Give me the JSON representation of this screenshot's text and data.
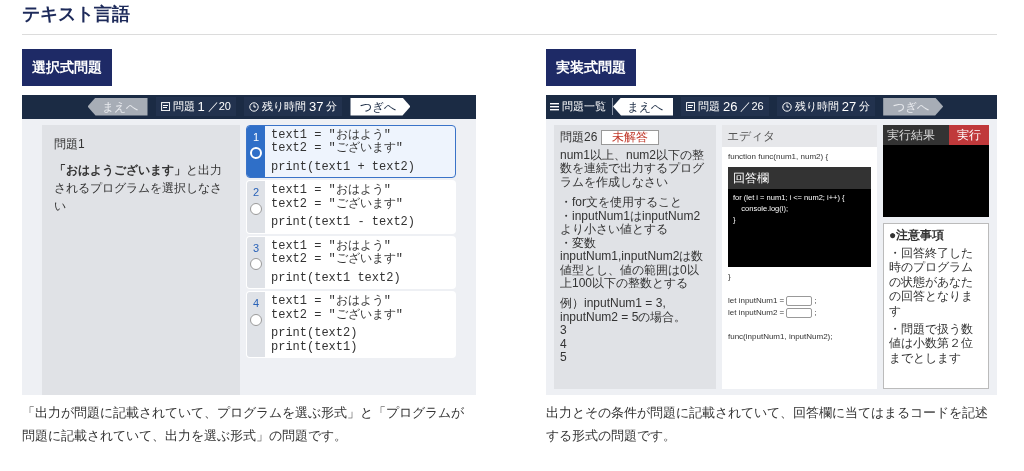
{
  "heading": "テキスト言語",
  "sections": [
    {
      "kind": "choice",
      "badge": "選択式問題",
      "screen": {
        "toolbar": {
          "prev": {
            "label": "まえへ",
            "disabled": true
          },
          "question_label": "問題",
          "current": "1",
          "total": "／20",
          "time_label": "残り時間",
          "minutes": "37",
          "unit": "分",
          "next": {
            "label": "つぎへ",
            "disabled": false
          }
        },
        "question": {
          "title": "問題1",
          "text": "**「おはようございます」**と出力されるプログラムを選択しなさい"
        },
        "choices": [
          {
            "number": "1",
            "code": "text1 = \"おはよう\"\ntext2 = \"ございます\"\n\nprint(text1 + text2)",
            "selected": true
          },
          {
            "number": "2",
            "code": "text1 = \"おはよう\"\ntext2 = \"ございます\"\n\nprint(text1 - text2)",
            "selected": false
          },
          {
            "number": "3",
            "code": "text1 = \"おはよう\"\ntext2 = \"ございます\"\n\nprint(text1 text2)",
            "selected": false
          },
          {
            "number": "4",
            "code": "text1 = \"おはよう\"\ntext2 = \"ございます\"\n\nprint(text2)\nprint(text1)",
            "selected": false
          }
        ]
      },
      "caption": "「出力が問題に記載されていて、プログラムを選ぶ形式」と「プログラムが問題に記載されていて、出力を選ぶ形式」の問題です。"
    },
    {
      "kind": "code",
      "badge": "実装式問題",
      "screen": {
        "toolbar": {
          "menu": "問題一覧",
          "prev": {
            "label": "まえへ",
            "disabled": false
          },
          "question_label": "問題",
          "current": "26",
          "total": "／26",
          "time_label": "残り時間",
          "minutes": "27",
          "unit": "分",
          "next": {
            "label": "つぎへ",
            "disabled": true
          }
        },
        "question": {
          "title": "問題26",
          "status": "未解答",
          "blocks": [
            [
              "num1以上、num2以下の整数を連続で出力するプログラムを作成しなさい"
            ],
            [
              "・for文を使用すること",
              "・inputNum1はinputNum2より小さい値とする",
              "・変数inputNum1,inputNum2は数値型とし、値の範囲は0以上100以下の整数とする"
            ],
            [
              "例）inputNum1 = 3, inputNum2 = 5の場合。",
              "3",
              "4",
              "5"
            ]
          ]
        },
        "editor": {
          "title": "エディタ",
          "before": "function func(num1, num2) {",
          "answer": {
            "title": "回答欄",
            "code": "for (let i = num1; i <= num2; i++) {\n    console.log(i);\n}"
          },
          "after": "}",
          "inputs": [
            {
              "label": "let inputNum1 =",
              "suffix": ";"
            },
            {
              "label": "let inputNum2 =",
              "suffix": ";"
            }
          ],
          "call": "func(inputNum1, inputNum2);"
        },
        "result": {
          "title": "実行結果",
          "run": "実行"
        },
        "notes": {
          "title": "●注意事項",
          "items": [
            "・回答終了した時のプログラムの状態があなたの回答となります",
            "・問題で扱う数値は小数第２位までとします"
          ]
        }
      },
      "caption": "出力とその条件が問題に記載されていて、回答欄に当てはまるコードを記述する形式の問題です。"
    }
  ]
}
